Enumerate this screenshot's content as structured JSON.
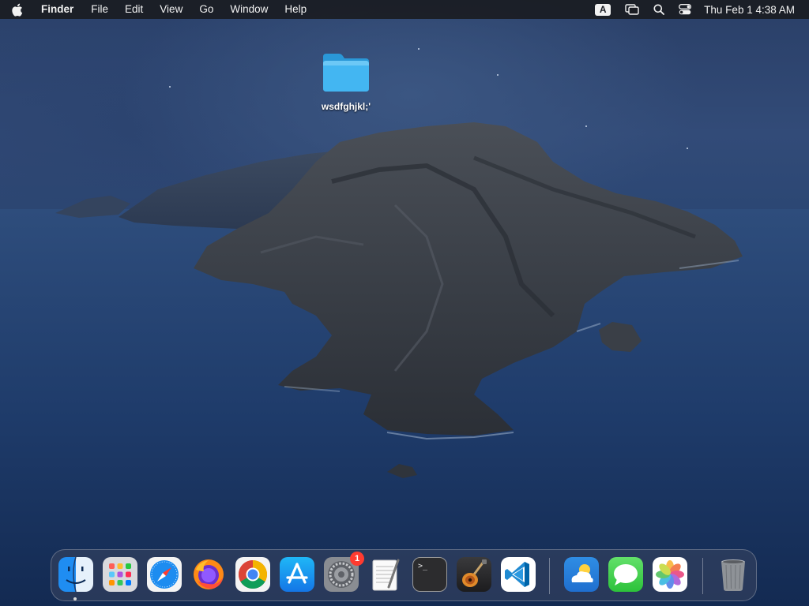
{
  "menubar": {
    "app_name": "Finder",
    "menus": [
      "File",
      "Edit",
      "View",
      "Go",
      "Window",
      "Help"
    ],
    "input_source": "A",
    "clock": "Thu Feb 1  4:38 AM"
  },
  "desktop": {
    "items": [
      {
        "label": "wsdfghjkl;'",
        "icon": "folder-icon"
      }
    ]
  },
  "dock": {
    "apps": [
      {
        "name": "Finder",
        "icon": "finder-icon",
        "running": true
      },
      {
        "name": "Launchpad",
        "icon": "launchpad-icon"
      },
      {
        "name": "Safari",
        "icon": "safari-icon"
      },
      {
        "name": "Firefox",
        "icon": "firefox-icon"
      },
      {
        "name": "Google Chrome",
        "icon": "chrome-icon"
      },
      {
        "name": "App Store",
        "icon": "app-store-icon"
      },
      {
        "name": "System Preferences",
        "icon": "system-preferences-icon",
        "badge": "1"
      },
      {
        "name": "TextEdit",
        "icon": "textedit-icon"
      },
      {
        "name": "Terminal",
        "icon": "terminal-icon",
        "glyph": ">_"
      },
      {
        "name": "GarageBand",
        "icon": "garageband-icon"
      },
      {
        "name": "Visual Studio Code",
        "icon": "vscode-icon"
      },
      {
        "name": "Weather",
        "icon": "weather-icon"
      },
      {
        "name": "Messages",
        "icon": "messages-icon"
      },
      {
        "name": "Photos",
        "icon": "photos-icon"
      },
      {
        "name": "Trash",
        "icon": "trash-icon"
      }
    ]
  },
  "colors": {
    "folder_blue": "#3fb3f0",
    "badge_red": "#ff3b30",
    "menubar_bg": "#1a1c22"
  }
}
